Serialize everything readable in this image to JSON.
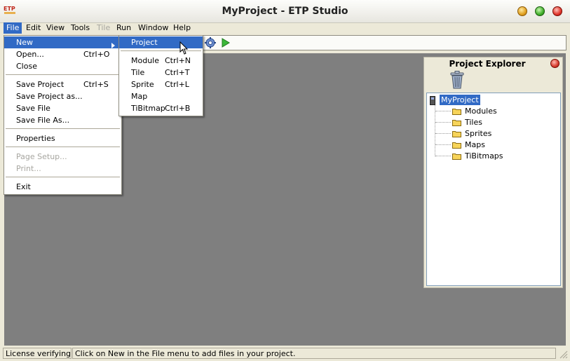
{
  "window": {
    "title": "MyProject - ETP Studio",
    "logo_text": "ETP"
  },
  "menubar": {
    "file": "File",
    "edit": "Edit",
    "view": "View",
    "tools": "Tools",
    "tile": "Tile",
    "run": "Run",
    "window": "Window",
    "help": "Help"
  },
  "file_menu": {
    "new": "New",
    "open": "Open...",
    "open_shortcut": "Ctrl+O",
    "close": "Close",
    "save_project": "Save Project",
    "save_project_shortcut": "Ctrl+S",
    "save_project_as": "Save Project as...",
    "save_file": "Save File",
    "save_file_as": "Save File As...",
    "properties": "Properties",
    "page_setup": "Page Setup...",
    "print": "Print...",
    "exit": "Exit"
  },
  "new_submenu": {
    "project": "Project",
    "module": "Module",
    "module_shortcut": "Ctrl+N",
    "tile": "Tile",
    "tile_shortcut": "Ctrl+T",
    "sprite": "Sprite",
    "sprite_shortcut": "Ctrl+L",
    "map": "Map",
    "tibitmap": "TiBitmap",
    "tibitmap_shortcut": "Ctrl+B"
  },
  "explorer": {
    "title": "Project Explorer",
    "root": "MyProject",
    "folders": [
      "Modules",
      "Tiles",
      "Sprites",
      "Maps",
      "TiBitmaps"
    ]
  },
  "status": {
    "left": "License verifying...",
    "message": "Click on New in the File menu to add files in your project."
  },
  "colors": {
    "highlight": "#316ac5",
    "workspace": "#7f7f7f",
    "window_bg": "#ece9d8"
  }
}
